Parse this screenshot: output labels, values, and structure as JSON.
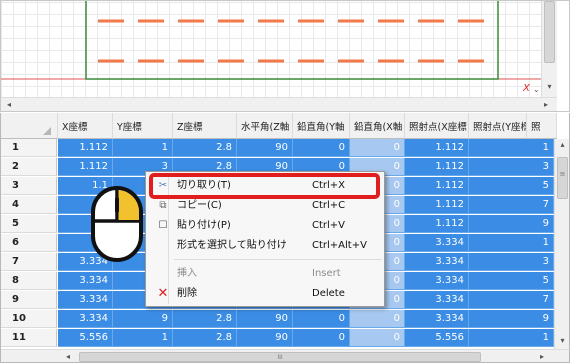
{
  "canvas": {
    "axis_label": "X"
  },
  "grid": {
    "columns": [
      "X座標",
      "Y座標",
      "Z座標",
      "水平角(Z軸",
      "鉛直角(Y軸",
      "鉛直角(X軸",
      "照射点(X座標",
      "照射点(Y座標",
      "照"
    ],
    "rows": [
      {
        "n": "1",
        "cells": [
          "1.112",
          "1",
          "2.8",
          "90",
          "0",
          "0",
          "1.112",
          "1"
        ]
      },
      {
        "n": "2",
        "cells": [
          "1.112",
          "3",
          "2.8",
          "90",
          "0",
          "0",
          "1.112",
          "3"
        ]
      },
      {
        "n": "3",
        "cells": [
          "1.1",
          "",
          "",
          "",
          "",
          "0",
          "1.112",
          "5"
        ]
      },
      {
        "n": "4",
        "cells": [
          "",
          "",
          "",
          "",
          "",
          "0",
          "1.112",
          "7"
        ]
      },
      {
        "n": "5",
        "cells": [
          "",
          "",
          "",
          "",
          "",
          "0",
          "1.112",
          "9"
        ]
      },
      {
        "n": "6",
        "cells": [
          "",
          "",
          "",
          "",
          "",
          "0",
          "3.334",
          "1"
        ]
      },
      {
        "n": "7",
        "cells": [
          "3.334",
          "",
          "",
          "",
          "",
          "0",
          "3.334",
          "3"
        ]
      },
      {
        "n": "8",
        "cells": [
          "3.334",
          "",
          "",
          "",
          "",
          "0",
          "3.334",
          "5"
        ]
      },
      {
        "n": "9",
        "cells": [
          "3.334",
          "",
          "",
          "",
          "",
          "0",
          "3.334",
          "7"
        ]
      },
      {
        "n": "10",
        "cells": [
          "3.334",
          "9",
          "2.8",
          "90",
          "0",
          "0",
          "3.334",
          "9"
        ]
      },
      {
        "n": "11",
        "cells": [
          "5.556",
          "1",
          "2.8",
          "90",
          "0",
          "0",
          "5.556",
          "1"
        ]
      }
    ]
  },
  "context_menu": {
    "cut": {
      "label": "切り取り(T)",
      "shortcut": "Ctrl+X",
      "icon": "scissors-icon"
    },
    "copy": {
      "label": "コピー(C)",
      "shortcut": "Ctrl+C",
      "icon": "copy-icon"
    },
    "paste": {
      "label": "貼り付け(P)",
      "shortcut": "Ctrl+V",
      "icon": "paste-icon"
    },
    "paste_special": {
      "label": "形式を選択して貼り付け",
      "shortcut": "Ctrl+Alt+V"
    },
    "insert": {
      "label": "挿入",
      "shortcut": "Insert"
    },
    "delete": {
      "label": "削除",
      "shortcut": "Delete",
      "icon": "red-x-icon"
    }
  },
  "colors": {
    "selection": "#3b8ce4",
    "highlight": "#e01e1e",
    "mouse_button": "#f2c12e",
    "frame": "#3a8a3a",
    "dash": "#f07a4a"
  },
  "scrollbar": {
    "h_thumb_glyph": "III"
  }
}
